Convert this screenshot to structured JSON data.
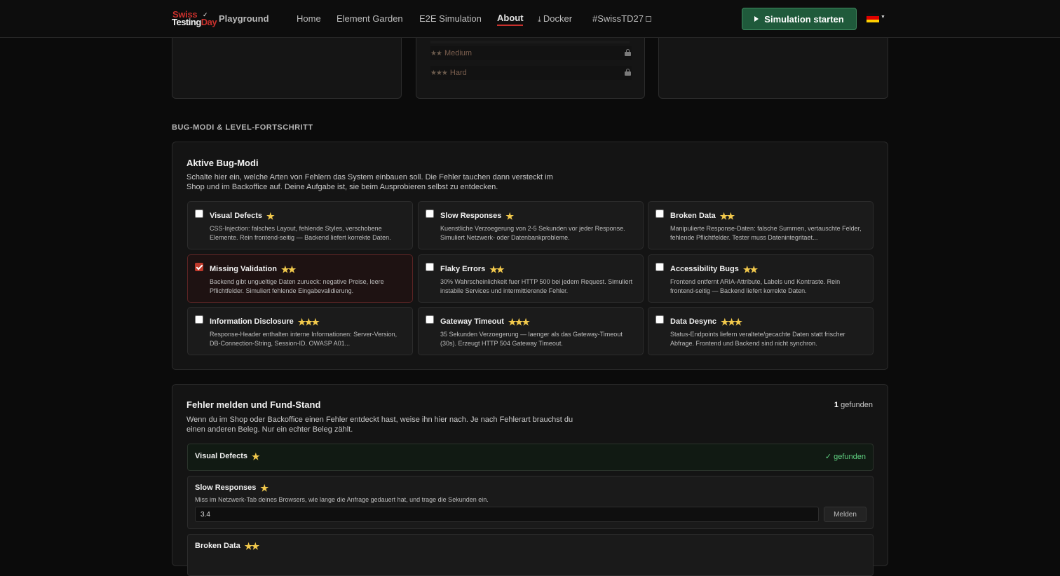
{
  "header": {
    "logo_line1": "Swiss",
    "logo_line2a": "Testing",
    "logo_line2b": "Day",
    "app_name": "Playground",
    "nav": [
      "Home",
      "Element Garden",
      "E2E Simulation",
      "About",
      "Docker",
      "#SwissTD27"
    ],
    "active_nav": "About",
    "start_button": "Simulation starten",
    "language_flag": "DE",
    "brand_color": "#c8302c"
  },
  "levels": {
    "rows": [
      {
        "stars": "★★",
        "label": "Medium",
        "locked": true
      },
      {
        "stars": "★★★",
        "label": "Hard",
        "locked": true
      }
    ]
  },
  "section_label": "BUG-MODI & LEVEL-FORTSCHRITT",
  "bug_modes": {
    "title": "Aktive Bug-Modi",
    "description": "Schalte hier ein, welche Arten von Fehlern das System einbauen soll. Die Fehler tauchen dann versteckt im Shop und im Backoffice auf. Deine Aufgabe ist, sie beim Ausprobieren selbst zu entdecken.",
    "modes": [
      {
        "name": "Visual Defects",
        "stars": "★",
        "checked": false,
        "desc": "CSS-Injection: falsches Layout, fehlende Styles, verschobene Elemente. Rein frontend-seitig — Backend liefert korrekte Daten."
      },
      {
        "name": "Slow Responses",
        "stars": "★",
        "checked": false,
        "desc": "Kuenstliche Verzoegerung von 2-5 Sekunden vor jeder Response. Simuliert Netzwerk- oder Datenbankprobleme."
      },
      {
        "name": "Broken Data",
        "stars": "★★",
        "checked": false,
        "desc": "Manipulierte Response-Daten: falsche Summen, vertauschte Felder, fehlende Pflichtfelder. Tester muss Datenintegritaet..."
      },
      {
        "name": "Missing Validation",
        "stars": "★★",
        "checked": true,
        "desc": "Backend gibt ungueltige Daten zurueck: negative Preise, leere Pflichtfelder. Simuliert fehlende Eingabevalidierung."
      },
      {
        "name": "Flaky Errors",
        "stars": "★★",
        "checked": false,
        "desc": "30% Wahrscheinlichkeit fuer HTTP 500 bei jedem Request. Simuliert instabile Services und intermittierende Fehler."
      },
      {
        "name": "Accessibility Bugs",
        "stars": "★★",
        "checked": false,
        "desc": "Frontend entfernt ARIA-Attribute, Labels und Kontraste. Rein frontend-seitig — Backend liefert korrekte Daten."
      },
      {
        "name": "Information Disclosure",
        "stars": "★★★",
        "checked": false,
        "desc": "Response-Header enthalten interne Informationen: Server-Version, DB-Connection-String, Session-ID. OWASP A01..."
      },
      {
        "name": "Gateway Timeout",
        "stars": "★★★",
        "checked": false,
        "desc": "35 Sekunden Verzoegerung — laenger als das Gateway-Timeout (30s). Erzeugt HTTP 504 Gateway Timeout."
      },
      {
        "name": "Data Desync",
        "stars": "★★★",
        "checked": false,
        "desc": "Status-Endpoints liefern veraltete/gecachte Daten statt frischer Abfrage. Frontend und Backend sind nicht synchron."
      }
    ]
  },
  "report": {
    "title": "Fehler melden und Fund-Stand",
    "description": "Wenn du im Shop oder Backoffice einen Fehler entdeckt hast, weise ihn hier nach. Je nach Fehlerart brauchst du einen anderen Beleg. Nur ein echter Beleg zählt.",
    "found_count": "1",
    "found_label": "gefunden",
    "rows": [
      {
        "name": "Visual Defects",
        "stars": "★",
        "status": "✓ gefunden"
      },
      {
        "name": "Slow Responses",
        "stars": "★",
        "hint": "Miss im Netzwerk-Tab deines Browsers, wie lange die Anfrage gedauert hat, und trage die Sekunden ein.",
        "input_value": "3.4",
        "button": "Melden"
      },
      {
        "name": "Broken Data",
        "stars": "★★"
      }
    ]
  }
}
